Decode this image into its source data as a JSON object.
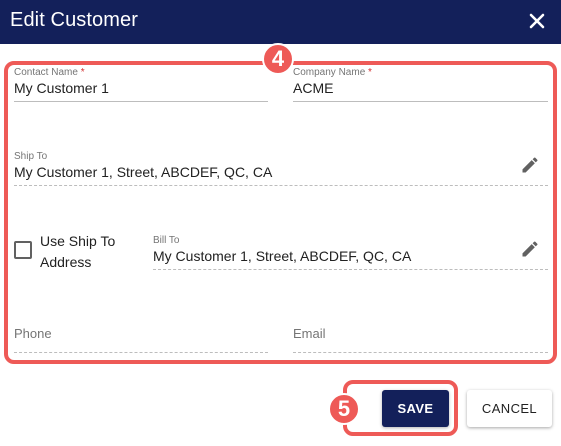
{
  "dialog": {
    "title": "Edit Customer"
  },
  "annotations": {
    "form_step": "4",
    "save_step": "5"
  },
  "form": {
    "contact_name": {
      "label": "Contact Name",
      "required_mark": "*",
      "value": "My Customer 1"
    },
    "company_name": {
      "label": "Company Name",
      "required_mark": "*",
      "value": "ACME"
    },
    "ship_to": {
      "label": "Ship To",
      "value": "My Customer 1, Street, ABCDEF, QC, CA"
    },
    "use_ship_to": {
      "label": "Use Ship To Address",
      "checked": false
    },
    "bill_to": {
      "label": "Bill To",
      "value": "My Customer 1, Street, ABCDEF, QC, CA"
    },
    "phone": {
      "placeholder": "Phone"
    },
    "email": {
      "placeholder": "Email"
    }
  },
  "actions": {
    "save_label": "SAVE",
    "cancel_label": "CANCEL"
  },
  "icons": {
    "close": "close-icon",
    "edit": "pencil-icon"
  },
  "colors": {
    "header_bg": "#13205a",
    "highlight": "#ee5a57",
    "required": "#d32f2f"
  }
}
